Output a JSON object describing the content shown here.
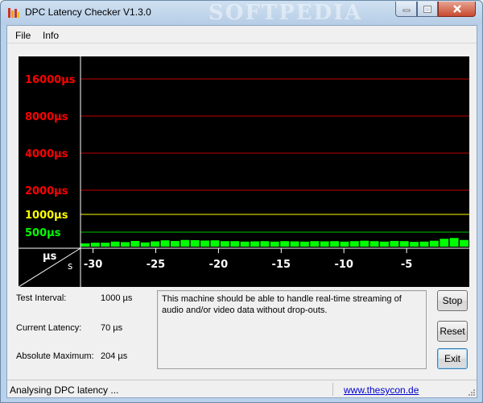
{
  "window": {
    "title": "DPC Latency Checker V1.3.0",
    "watermark": "SOFTPEDIA"
  },
  "menu": {
    "items": [
      {
        "label": "File"
      },
      {
        "label": "Info"
      }
    ]
  },
  "chart_data": {
    "type": "bar",
    "ylabels": [
      {
        "label": "16000µs",
        "color": "#ff0000",
        "line": "#c00000"
      },
      {
        "label": "8000µs",
        "color": "#ff0000",
        "line": "#c00000"
      },
      {
        "label": "4000µs",
        "color": "#ff0000",
        "line": "#c00000"
      },
      {
        "label": "2000µs",
        "color": "#ff0000",
        "line": "#c00000"
      },
      {
        "label": "1000µs",
        "color": "#ffff00",
        "line": "#ffff00"
      },
      {
        "label": "500µs",
        "color": "#00ff00",
        "line": "#00c000"
      }
    ],
    "x_axis_unit": "s",
    "y_axis_unit": "µs",
    "x_ticks": [
      "-30",
      "-25",
      "-20",
      "-15",
      "-10",
      "-5"
    ],
    "x_range_s": [
      -31,
      0
    ],
    "values_us": [
      60,
      70,
      70,
      90,
      80,
      105,
      75,
      95,
      120,
      105,
      130,
      125,
      115,
      120,
      100,
      100,
      90,
      95,
      100,
      90,
      100,
      95,
      90,
      100,
      95,
      100,
      90,
      100,
      110,
      100,
      90,
      105,
      100,
      85,
      90,
      110,
      170,
      204,
      130
    ],
    "bar_color": "#00ff00",
    "background": "#000000"
  },
  "stats": {
    "test_interval_label": "Test Interval:",
    "test_interval_value": "1000 µs",
    "current_latency_label": "Current Latency:",
    "current_latency_value": "70 µs",
    "absolute_maximum_label": "Absolute Maximum:",
    "absolute_maximum_value": "204 µs"
  },
  "message": "This machine should be able to handle real-time streaming of audio and/or video data without drop-outs.",
  "buttons": {
    "stop": "Stop",
    "reset": "Reset",
    "exit": "Exit"
  },
  "status": {
    "text": "Analysing DPC latency ...",
    "link": "www.thesycon.de"
  }
}
